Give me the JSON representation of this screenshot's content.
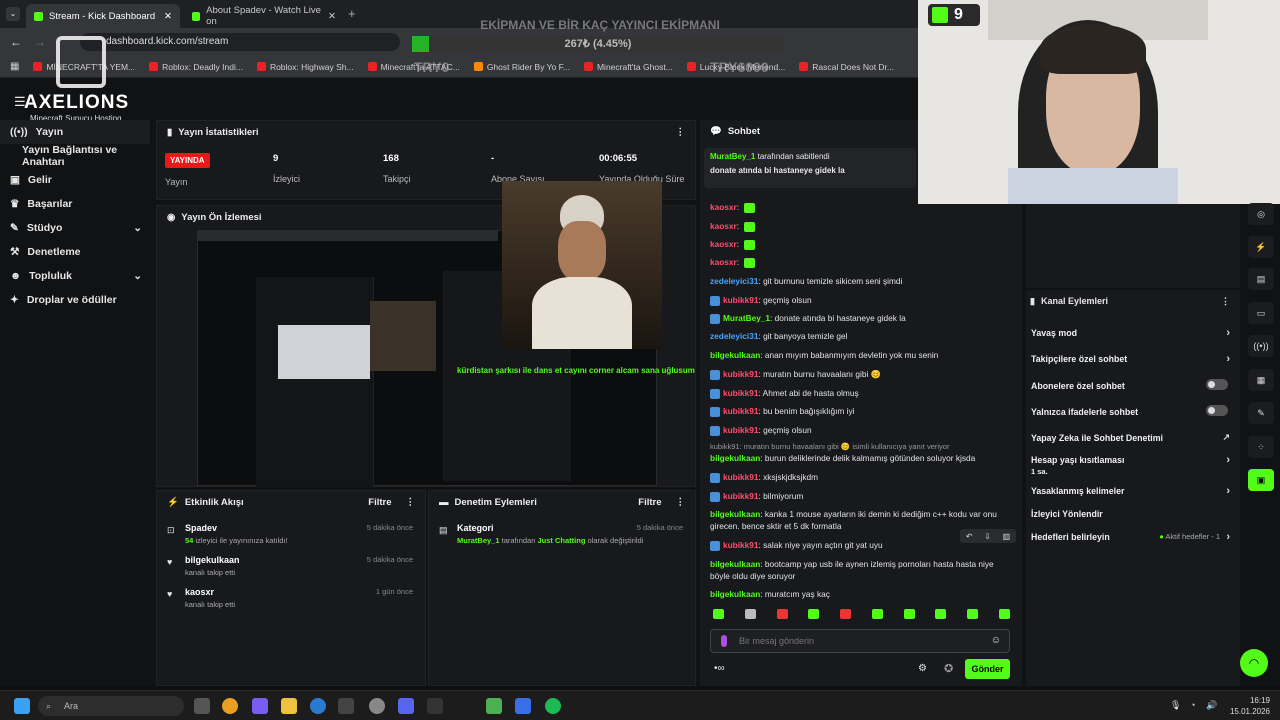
{
  "browser": {
    "tabs": [
      {
        "label": "Stream - Kick Dashboard"
      },
      {
        "label": "About Spadev - Watch Live on"
      }
    ],
    "url": "dashboard.kick.com/stream",
    "bookmarks": [
      "MİNECRAFT'TA YEM...",
      "Roblox: Deadly Indi...",
      "Roblox: Highway Sh...",
      "Minecraft'ta ATTAC...",
      "Ghost Rider By Yo F...",
      "Minecraft'ta Ghost...",
      "Lucky Block Merlend...",
      "Rascal Does Not Dr..."
    ]
  },
  "overlay": {
    "goal_title": "EKİPMAN VE BİR KAÇ YAYINCI EKİPMANI",
    "goal_progress": "267₺ (4.45%)",
    "goal_fraction": 0.0445,
    "goal_left": "TRY0",
    "goal_right": "TRY6000",
    "logo_text": "AXELIONS",
    "logo_sub": "Minecraft Sunucu Hosting",
    "kick_counter": "9"
  },
  "sidebar": {
    "items": [
      {
        "label": "Yayın",
        "icon": "broadcast-icon"
      },
      {
        "label": "Yayın Bağlantısı ve Anahtarı"
      },
      {
        "label": "Gelir",
        "icon": "dollar-icon"
      },
      {
        "label": "Başarılar",
        "icon": "trophy-icon"
      },
      {
        "label": "Stüdyo",
        "icon": "studio-icon"
      },
      {
        "label": "Denetleme",
        "icon": "shield-icon"
      },
      {
        "label": "Topluluk",
        "icon": "community-icon"
      },
      {
        "label": "Droplar ve ödüller",
        "icon": "gift-icon"
      }
    ]
  },
  "stats": {
    "title": "Yayın İstatistikleri",
    "live_badge": "YAYINDA",
    "live_label": "Yayın",
    "viewers": "9",
    "viewers_label": "İzleyici",
    "followers": "168",
    "followers_label": "Takipçi",
    "subs": "-",
    "subs_label": "Abone Sayısı",
    "duration": "00:06:55",
    "duration_label": "Yayında Olduğu Süre"
  },
  "preview": {
    "title": "Yayın Ön İzlemesi",
    "caption": "kürdistan şarkısı ile dans et cayını corner alcam sana uğlusum"
  },
  "activity": {
    "title": "Etkinlik Akışı",
    "filter": "Filtre",
    "items": [
      {
        "title": "Spadev",
        "sub_count": "54",
        "sub": "izleyici ile yayınınıza katıldı!",
        "time": "5 dakika önce"
      },
      {
        "title": "bilgekulkaan",
        "sub": "kanalı takip etti",
        "time": "5 dakika önce"
      },
      {
        "title": "kaosxr",
        "sub": "kanalı takip etti",
        "time": "1 gün önce"
      }
    ]
  },
  "moderation": {
    "title": "Denetim Eylemleri",
    "filter": "Filtre",
    "item": {
      "title": "Kategori",
      "user": "MuratBey_1",
      "mid": "tarafından",
      "category": "Just Chatting",
      "tail": "olarak değiştirildi",
      "time": "5 dakika önce"
    }
  },
  "chat": {
    "title": "Sohbet",
    "pinned_by": "MuratBey_1",
    "pinned_suffix": "tarafından sabitlendi",
    "pinned_text": "donate atında bi hastaneye gidek la",
    "messages": [
      {
        "user": "kaosxr",
        "text": "",
        "color": "#ff4d6d",
        "emote": true
      },
      {
        "user": "kaosxr",
        "text": "",
        "color": "#ff4d6d",
        "emote": true
      },
      {
        "user": "kaosxr",
        "text": "",
        "color": "#ff4d6d",
        "emote": true
      },
      {
        "user": "kaosxr",
        "text": "",
        "color": "#ff4d6d",
        "emote": true
      },
      {
        "user": "zedeleyici31",
        "text": "git burnunu temizle sikicem seni şimdi",
        "color": "#4aa3ff"
      },
      {
        "user": "kubikk91",
        "text": "geçmiş olsun",
        "color": "#ff4d6d",
        "badge": true
      },
      {
        "user": "MuratBey_1",
        "text": "donate atında bi hastaneye gidek la",
        "color": "#53fc18",
        "badge": true
      },
      {
        "user": "zedeleyici31",
        "text": "git banyoya temizle gel",
        "color": "#4aa3ff"
      },
      {
        "user": "bilgekulkaan",
        "text": "anan mıyım babanmıyım devletin yok mu senin",
        "color": "#53fc18"
      },
      {
        "user": "kubikk91",
        "text": "muratın burnu havaalanı gibi 😊",
        "color": "#ff4d6d",
        "badge": true
      },
      {
        "user": "kubikk91",
        "text": "Ahmet abi de hasta olmuş",
        "color": "#ff4d6d",
        "badge": true
      },
      {
        "user": "kubikk91",
        "text": "bu benim bağışıklığım iyi",
        "color": "#ff4d6d",
        "badge": true
      },
      {
        "user": "kubikk91",
        "text": "geçmiş olsun",
        "color": "#ff4d6d",
        "badge": true
      },
      {
        "user": "bilgekulkaan",
        "text": "burun deliklerinde delik kalmamış götünden soluyor kjsda",
        "color": "#53fc18"
      },
      {
        "user": "kubikk91",
        "text": "xksjskjdksjkdm",
        "color": "#ff4d6d",
        "badge": true
      },
      {
        "user": "kubikk91",
        "text": "bilmiyorum",
        "color": "#ff4d6d",
        "badge": true
      },
      {
        "user": "bilgekulkaan",
        "text": "kanka 1 mouse ayarların iki demin ki dediğim c++ kodu var onu girecen. bence sktir et 5 dk formatla",
        "color": "#53fc18"
      },
      {
        "user": "kubikk91",
        "text": "salak niye yayın açtın git yat uyu",
        "color": "#ff4d6d",
        "badge": true
      },
      {
        "user": "bilgekulkaan",
        "text": "bootcamp yap usb ile aynen izlemiş pornoları hasta hasta niye böyle oldu diye soruyor",
        "color": "#53fc18"
      },
      {
        "user": "bilgekulkaan",
        "text": "muratcım yaş kaç",
        "color": "#53fc18"
      }
    ],
    "reply_note": "kubikk91: muratın burnu havaalanı gibi 😊 isimli kullanıcıya yanıt veriyor",
    "input_placeholder": "Bir mesaj gönderin",
    "send": "Gönder"
  },
  "channel_actions": {
    "title": "Kanal Eylemleri",
    "items": [
      {
        "label": "Yavaş mod",
        "ctl": "chevron"
      },
      {
        "label": "Takipçilere özel sohbet",
        "ctl": "chevron"
      },
      {
        "label": "Abonelere özel sohbet",
        "ctl": "toggle"
      },
      {
        "label": "Yalnızca ifadelerle sohbet",
        "ctl": "toggle"
      },
      {
        "label": "Yapay Zeka ile Sohbet Denetimi",
        "ctl": "external"
      },
      {
        "label": "Hesap yaşı kısıtlaması",
        "sub": "1 sa.",
        "ctl": "chevron"
      },
      {
        "label": "Yasaklanmış kelimeler",
        "ctl": "chevron"
      },
      {
        "label": "İzleyici Yönlendir",
        "ctl": "none"
      },
      {
        "label": "Hedefleri belirleyin",
        "status": "Aktif hedefler - 1",
        "ctl": "chevron"
      }
    ]
  },
  "taskbar": {
    "search": "Ara",
    "time": "16:19",
    "date": "15.01.2026"
  },
  "colors": {
    "accent": "#53fc18",
    "live": "#e91916",
    "panel": "#18191c"
  }
}
